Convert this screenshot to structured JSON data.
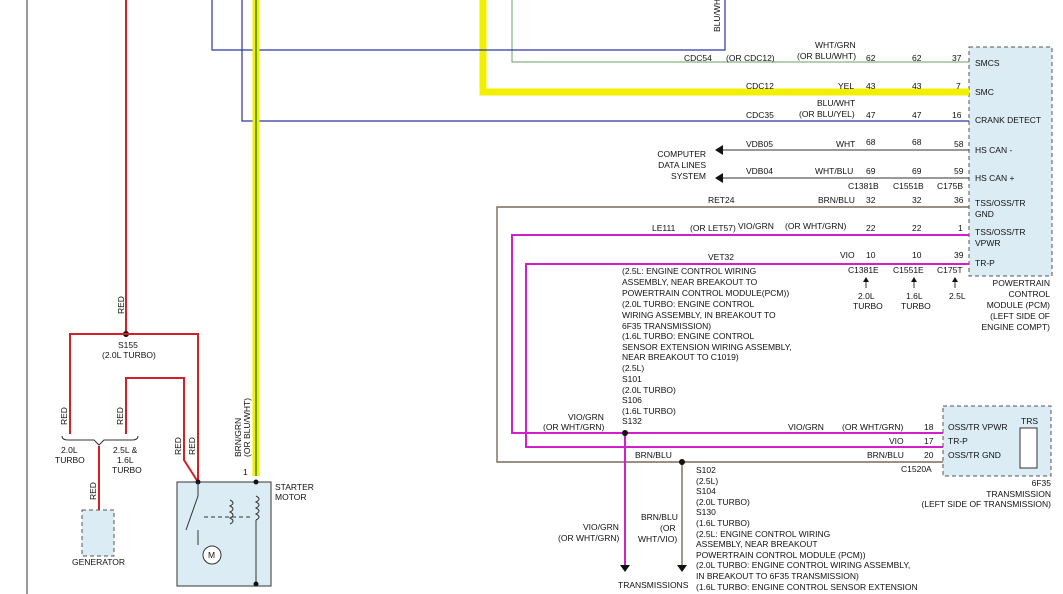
{
  "circuits": {
    "cdc54": "CDC54",
    "cdc54_alt": "(OR CDC12)",
    "cdc12": "CDC12",
    "cdc35": "CDC35",
    "vdb05": "VDB05",
    "vdb04": "VDB04",
    "ret24": "RET24",
    "le111": "LE111",
    "le111_alt": "(OR LET57)",
    "vet32": "VET32"
  },
  "colors": {
    "wht_grn": "WHT/GRN",
    "or_blu_wht": "(OR BLU/WHT)",
    "yel": "YEL",
    "blu_wht": "BLU/WHT",
    "or_blu_yel": "(OR BLU/YEL)",
    "wht": "WHT",
    "wht_blu": "WHT/BLU",
    "brn_blu": "BRN/BLU",
    "vio_grn": "VIO/GRN",
    "or_wht_grn": "(OR WHT/GRN)",
    "vio": "VIO",
    "red": "RED",
    "brn_grn": "BRN/GRN",
    "or_blu_wht_paren": "(OR BLU/WHT)",
    "blu_wht_top": "BLU/WHT",
    "or": "(OR",
    "wht_vio": "WHT/VIO)"
  },
  "pins": {
    "p62a": "62",
    "p62b": "62",
    "p37": "37",
    "p43a": "43",
    "p43b": "43",
    "p7": "7",
    "p47a": "47",
    "p47b": "47",
    "p16": "16",
    "p68a": "68",
    "p68b": "68",
    "p58": "58",
    "p69a": "69",
    "p69b": "69",
    "p59": "59",
    "p32a": "32",
    "p32b": "32",
    "p36": "36",
    "p22a": "22",
    "p22b": "22",
    "p1": "1",
    "p10a": "10",
    "p10b": "10",
    "p39": "39",
    "t18": "18",
    "t17": "17",
    "t20": "20",
    "s1": "1"
  },
  "connectors": {
    "c1381b": "C1381B",
    "c1551b": "C1551B",
    "c175b": "C175B",
    "c1381e": "C1381E",
    "c1551e": "C1551E",
    "c175t": "C175T",
    "c1520a": "C1520A",
    "v20": "2.0L",
    "v20t": "TURBO",
    "v16": "1.6L",
    "v16t": "TURBO",
    "v25": "2.5L"
  },
  "pcm": {
    "pins": [
      "SMCS",
      "SMC",
      "CRANK DETECT",
      "HS CAN -",
      "HS CAN +",
      "TSS/OSS/TR",
      "GND",
      "TSS/OSS/TR",
      "VPWR",
      "TR-P"
    ],
    "caption": [
      "POWERTRAIN",
      "CONTROL",
      "MODULE (PCM)",
      "(LEFT SIDE OF",
      "ENGINE COMPT)"
    ]
  },
  "trs": {
    "label": "TRS",
    "pins": [
      "OSS/TR VPWR",
      "TR-P",
      "OSS/TR GND"
    ],
    "caption": [
      "6F35",
      "TRANSMISSION",
      "(LEFT SIDE OF TRANSMISSION)"
    ]
  },
  "computer_lines": [
    "COMPUTER",
    "DATA LINES",
    "SYSTEM"
  ],
  "splice_note_1": [
    "(2.5L: ENGINE CONTROL WIRING",
    "ASSEMBLY, NEAR BREAKOUT TO",
    "POWERTRAIN CONTROL MODULE(PCM))",
    "(2.0L TURBO: ENGINE CONTROL",
    "WIRING ASSEMBLY, IN BREAKOUT TO",
    "6F35 TRANSMISSION)",
    "(1.6L TURBO: ENGINE CONTROL",
    "SENSOR EXTENSION WIRING ASSEMBLY,",
    "NEAR BREAKOUT TO C1019)",
    "(2.5L)",
    "S101",
    "(2.0L TURBO)",
    "S106",
    "(1.6L TURBO)",
    "S132"
  ],
  "splice_note_2": [
    "S102",
    "(2.5L)",
    "S104",
    "(2.0L TURBO)",
    "S130",
    "(1.6L TURBO)",
    "(2.5L: ENGINE CONTROL WIRING",
    "ASSEMBLY, NEAR BREAKOUT",
    "POWERTRAIN CONTROL MODULE (PCM))",
    "(2.0L TURBO: ENGINE CONTROL WIRING ASSEMBLY,",
    "IN BREAKOUT TO 6F35 TRANSMISSION)",
    "(1.6L TURBO: ENGINE CONTROL SENSOR EXTENSION"
  ],
  "transmissions_label": "TRANSMISSIONS",
  "s155": "S155",
  "s155_v": "(2.0L TURBO)",
  "v20_left": "2.0L",
  "turbo_left": "TURBO",
  "v25_16": "2.5L &",
  "v16_left": "1.6L",
  "turbo_left2": "TURBO",
  "generator": "GENERATOR",
  "starter": [
    "STARTER",
    "MOTOR"
  ],
  "motor_symbol": "M"
}
